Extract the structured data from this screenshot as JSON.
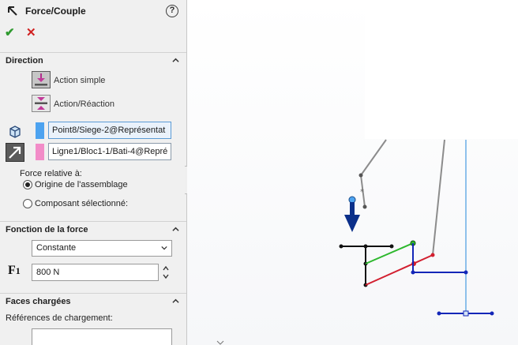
{
  "header": {
    "title": "Force/Couple",
    "help_symbol": "?",
    "ok_symbol": "✔",
    "cancel_symbol": "✕"
  },
  "direction": {
    "section_label": "Direction",
    "option_simple": "Action simple",
    "option_reaction": "Action/Réaction",
    "selected_option": "Action simple",
    "selection_1": "Point8/Siege-2@Représentat",
    "selection_1_color": "#4da3f0",
    "selection_2": "Ligne1/Bloc1-1/Bati-4@Repré",
    "selection_2_color": "#f28cc8",
    "relative_label": "Force relative à:",
    "radio_origin": "Origine de l'assemblage",
    "radio_component": "Composant sélectionné:",
    "selected_radio": "Origine de l'assemblage"
  },
  "force_function": {
    "section_label": "Fonction de la force",
    "type_value": "Constante",
    "symbol_main": "F",
    "symbol_sub": "1",
    "value": "800 N"
  },
  "loaded_faces": {
    "section_label": "Faces chargées",
    "references_label": "Références de chargement:"
  },
  "icons": {
    "pm": "force-pointer-icon",
    "help": "help-icon",
    "ok": "checkmark-icon",
    "cancel": "close-icon",
    "collapse": "chevron-up-icon",
    "dropdown": "chevron-down-icon"
  },
  "colors": {
    "force_arrow": "#0b2f8a",
    "link_green": "#2db82d",
    "link_red": "#d21f2f",
    "link_blue": "#1427b8",
    "axis_blue": "#6aaee6",
    "link_gray": "#888888"
  }
}
